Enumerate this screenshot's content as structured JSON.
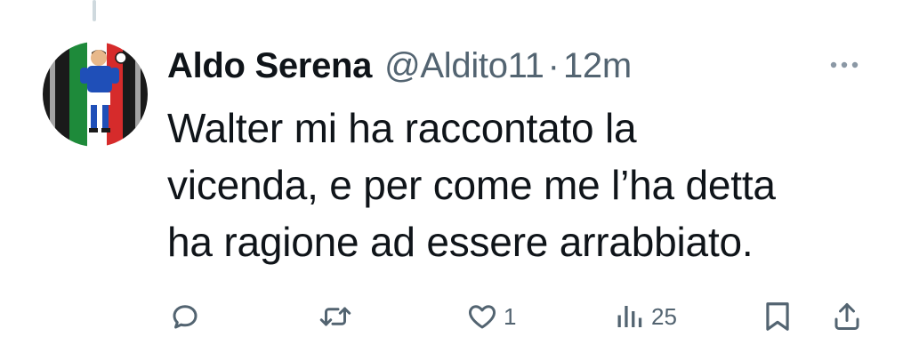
{
  "tweet": {
    "author_name": "Aldo Serena",
    "handle": "@Aldito11",
    "separator": "·",
    "time": "12m",
    "text": "Walter mi ha raccontato la\nvicenda, e per come me l’ha detta\nha ragione ad essere arrabbiato."
  },
  "avatar": {
    "icon": "avatar-footballer-italian-flag",
    "colors": {
      "green": "#1e8a3a",
      "white": "#ffffff",
      "red": "#d62b2b",
      "black": "#1a1a1a",
      "jersey": "#1f4fb8"
    }
  },
  "actions": {
    "reply": {
      "icon": "reply-icon",
      "count": ""
    },
    "retweet": {
      "icon": "retweet-icon",
      "count": ""
    },
    "like": {
      "icon": "heart-icon",
      "count": "1"
    },
    "views": {
      "icon": "views-icon",
      "count": "25"
    },
    "bookmark": {
      "icon": "bookmark-icon",
      "count": ""
    },
    "share": {
      "icon": "share-icon",
      "count": ""
    }
  },
  "colors": {
    "text_primary": "#0f1419",
    "text_secondary": "#536471",
    "thread_line": "#cfd9de"
  }
}
